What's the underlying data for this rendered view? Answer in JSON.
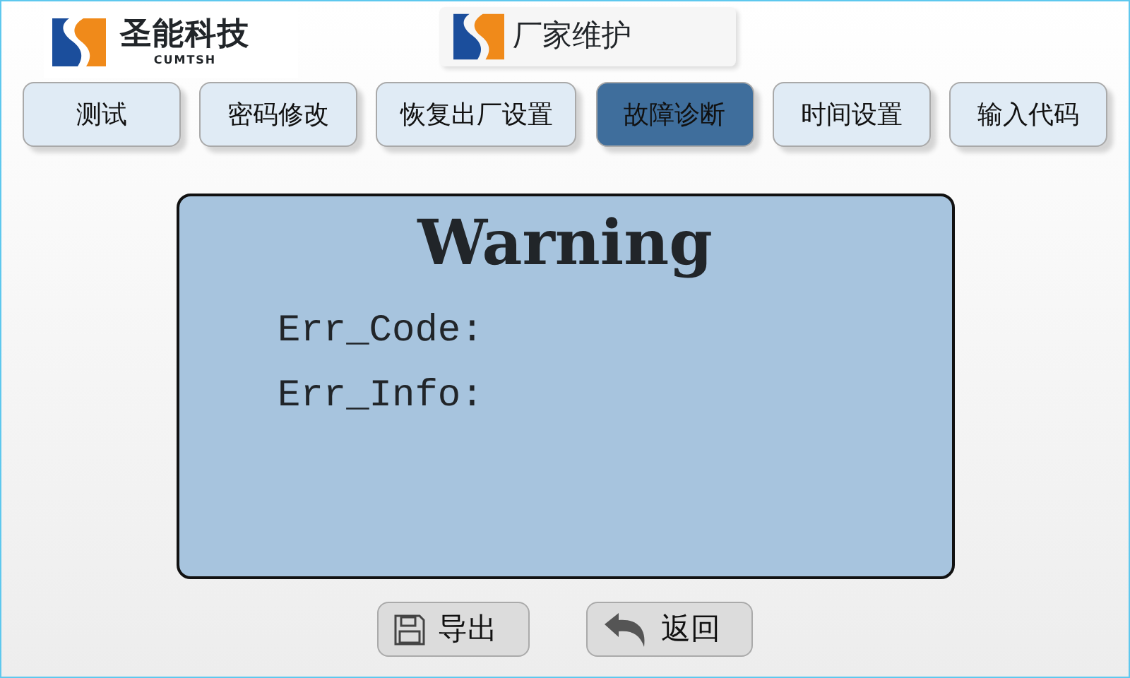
{
  "logo": {
    "name": "圣能科技",
    "subtitle": "CUMTSH"
  },
  "header": {
    "title": "厂家维护"
  },
  "tabs": [
    {
      "label": "测试",
      "selected": false
    },
    {
      "label": "密码修改",
      "selected": false
    },
    {
      "label": "恢复出厂设置",
      "selected": false
    },
    {
      "label": "故障诊断",
      "selected": true
    },
    {
      "label": "时间设置",
      "selected": false
    },
    {
      "label": "输入代码",
      "selected": false
    }
  ],
  "panel": {
    "title": "Warning",
    "fields": [
      "Err_Code:",
      "Err_Info:"
    ]
  },
  "buttons": [
    {
      "label": "导出",
      "kind": "export"
    },
    {
      "label": "返回",
      "kind": "back"
    }
  ]
}
